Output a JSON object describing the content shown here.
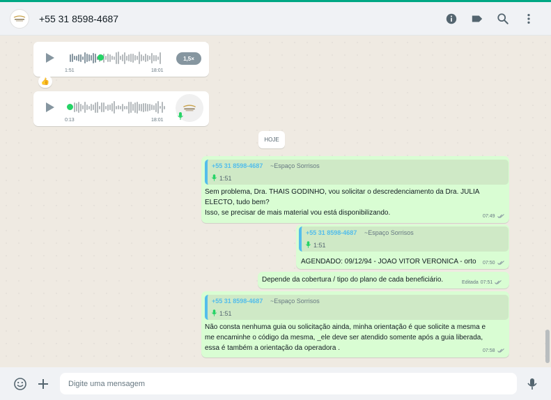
{
  "header": {
    "contact_name": "+55 31 8598-4687",
    "icons": [
      "info-icon",
      "label-icon",
      "search-icon",
      "menu-icon"
    ]
  },
  "messages": {
    "audio1": {
      "duration": "1:51",
      "time": "18:01",
      "speed": "1,5×",
      "reaction": "👍",
      "progress": 0.32
    },
    "audio2": {
      "duration": "0:13",
      "time": "18:01",
      "progress": 0.0
    },
    "date_chip": "HOJE",
    "m1": {
      "quote_name": "+55 31 8598-4687",
      "quote_pushname": "~Espaço Sorrisos",
      "quote_duration": "1:51",
      "text": "Sem problema, Dra. THAIS GODINHO, vou solicitar o descredenciamento da Dra. JULIA\nELECTO, tudo bem?\nIsso, se precisar de mais material vou está disponibilizando.",
      "time": "07:49"
    },
    "m2": {
      "quote_name": "+55 31 8598-4687",
      "quote_pushname": "~Espaço Sorrisos",
      "quote_duration": "1:51",
      "text": "AGENDADO: 09/12/94 - JOAO VITOR VERONICA - orto",
      "time": "07:50"
    },
    "m3": {
      "text": "Depende da cobertura / tipo do plano de cada beneficiário.",
      "edited": "Editada",
      "time": "07:51"
    },
    "m4": {
      "quote_name": "+55 31 8598-4687",
      "quote_pushname": "~Espaço Sorrisos",
      "quote_duration": "1:51",
      "text": "Não consta nenhuma guia ou solicitação ainda, minha orientação é que solicite a mesma e\nme encaminhe o código da mesma, _ele deve ser atendido somente após a guia liberada,\nessa é também a orientação da operadora .",
      "time": "07:58"
    }
  },
  "footer": {
    "placeholder": "Digite uma mensagem",
    "value": ""
  },
  "colors": {
    "accent": "#00a884",
    "outgoing_bubble": "#d9fdd3",
    "quote_name": "#53bdeb",
    "read_ticks": "#8696a0"
  }
}
